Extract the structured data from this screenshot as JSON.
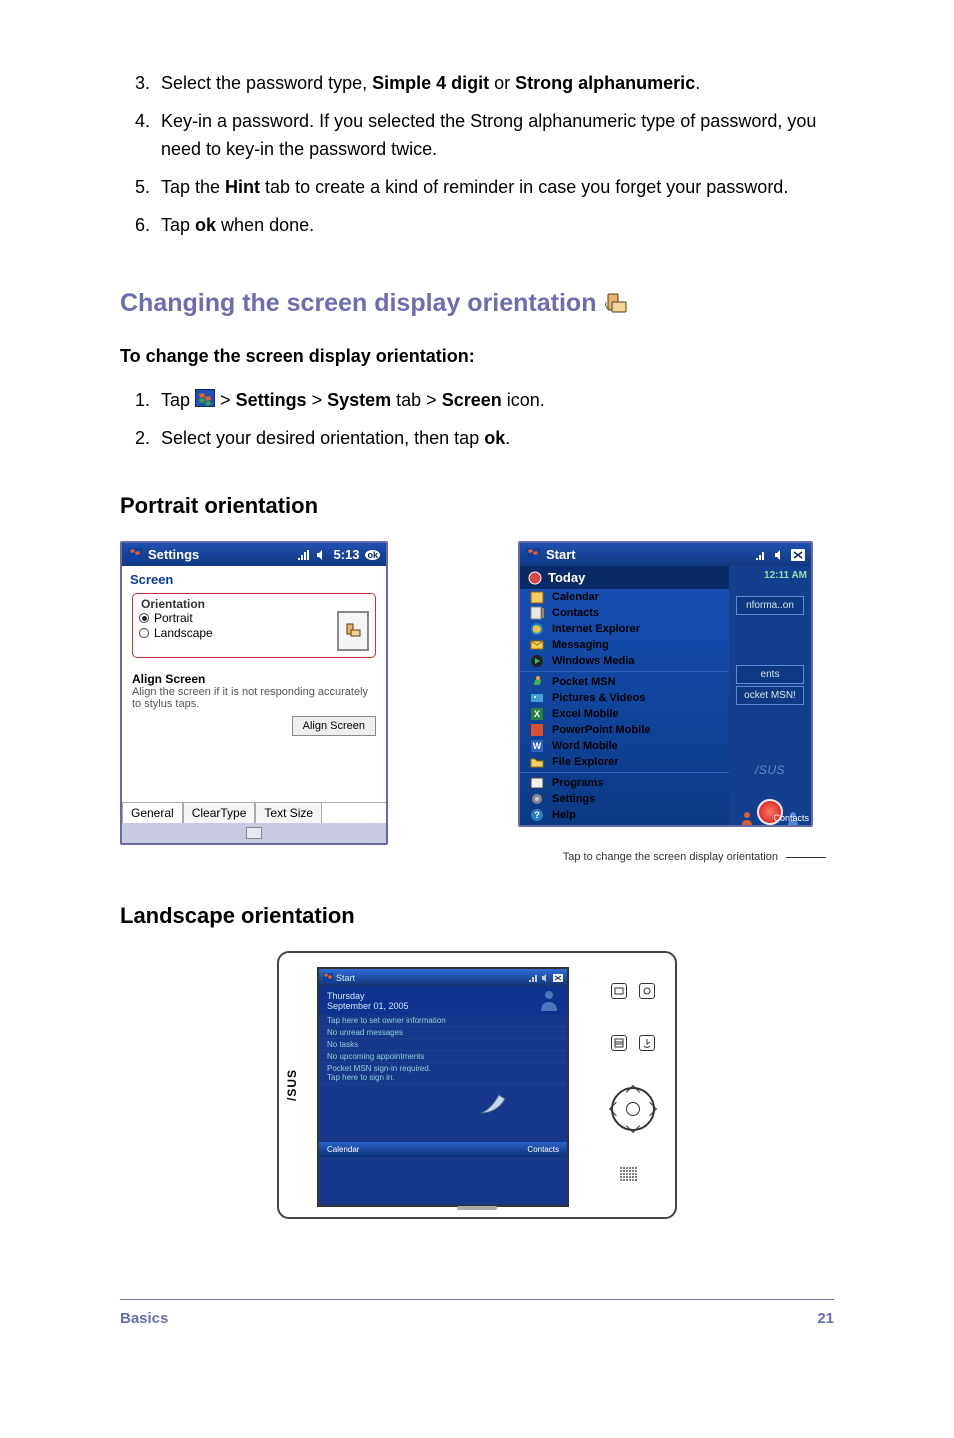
{
  "steps_top": [
    {
      "pre": "Select the password type, ",
      "b1": "Simple 4 digit",
      "mid": " or ",
      "b2": "Strong alphanumeric",
      "post": "."
    },
    {
      "text": "Key-in a password. If you selected the Strong alphanumeric type of password, you need to key-in the password twice."
    },
    {
      "pre": "Tap the ",
      "b1": "Hint",
      "post": " tab to create a kind of reminder in case you forget your password."
    },
    {
      "pre": "Tap ",
      "b1": "ok",
      "post": " when done."
    }
  ],
  "section_title": "Changing the screen display orientation",
  "to_change_heading": "To change the screen display orientation:",
  "steps_change": {
    "s1_pre": "Tap ",
    "s1_sep": " > ",
    "s1_b1": "Settings",
    "s1_b2": "System",
    "s1_tab": " tab > ",
    "s1_b3": "Screen",
    "s1_post": " icon.",
    "s2_pre": "Select your desired orientation, then tap ",
    "s2_b1": "ok",
    "s2_post": "."
  },
  "portrait_heading": "Portrait orientation",
  "landscape_heading": "Landscape orientation",
  "caption": "Tap to change the screen display orientation",
  "settings_screen": {
    "title": "Settings",
    "time": "5:13",
    "header": "Screen",
    "orientation_label": "Orientation",
    "portrait": "Portrait",
    "landscape": "Landscape",
    "align_hdr": "Align Screen",
    "align_txt": "Align the screen if it is not responding accurately to stylus taps.",
    "align_btn": "Align Screen",
    "tabs": [
      "General",
      "ClearType",
      "Text Size"
    ]
  },
  "start_screen": {
    "title": "Start",
    "today": "Today",
    "time": "12:11 AM",
    "items": [
      "Calendar",
      "Contacts",
      "Internet Explorer",
      "Messaging",
      "Windows Media",
      "Pocket MSN",
      "Pictures & Videos",
      "Excel Mobile",
      "PowerPoint Mobile",
      "Word Mobile",
      "File Explorer"
    ],
    "group2": [
      "Programs",
      "Settings",
      "Help"
    ],
    "right": {
      "info": "nforma..on",
      "ents": "ents",
      "msn": "ocket MSN!"
    },
    "contacts": "Contacts"
  },
  "pda_screen": {
    "brand": "/SUS",
    "titlebar": "Start",
    "today_hdr": "Thursday\nSeptember 01, 2005",
    "items": [
      "Tap here to set owner information",
      "No unread messages",
      "No tasks",
      "No upcoming appointments",
      "Pocket MSN sign-in required.\nTap here to sign in."
    ],
    "bottom_left": "Calendar",
    "bottom_right": "Contacts"
  },
  "footer": {
    "left": "Basics",
    "right": "21"
  }
}
